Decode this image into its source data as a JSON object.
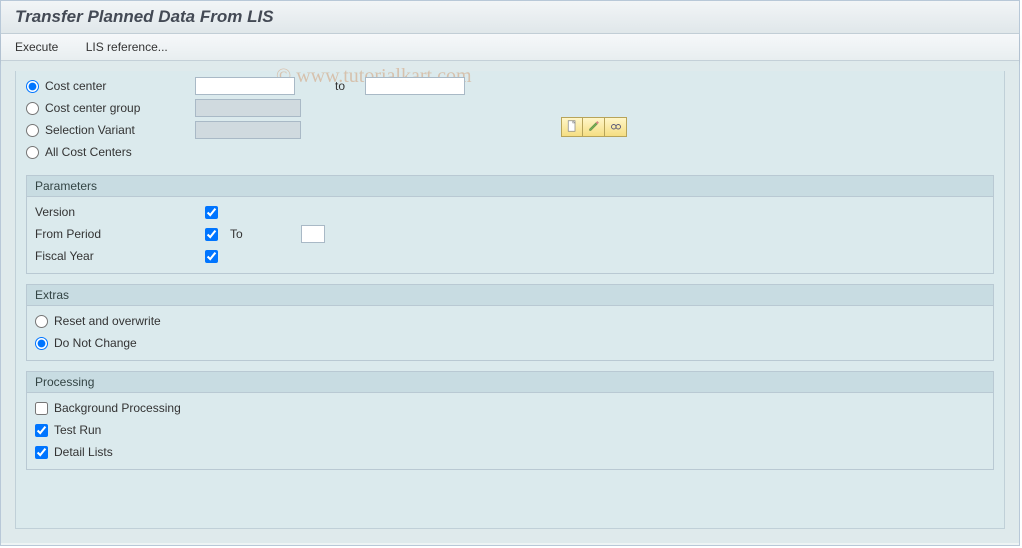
{
  "title": "Transfer Planned Data From LIS",
  "toolbar": {
    "execute": "Execute",
    "lis_ref": "LIS reference..."
  },
  "watermark": "© www.tutorialkart.com",
  "selection": {
    "opt1": "Cost center",
    "opt2": "Cost center group",
    "opt3": "Selection Variant",
    "opt4": "All Cost Centers",
    "to": "to",
    "cc_from": "",
    "cc_to": "",
    "ccgrp": "",
    "selvar": ""
  },
  "parameters": {
    "title": "Parameters",
    "version": "Version",
    "from_period": "From Period",
    "to": "To",
    "fiscal_year": "Fiscal Year",
    "to_val": ""
  },
  "extras": {
    "title": "Extras",
    "opt1": "Reset and overwrite",
    "opt2": "Do Not Change"
  },
  "processing": {
    "title": "Processing",
    "opt1": "Background Processing",
    "opt2": "Test Run",
    "opt3": "Detail Lists"
  },
  "icons": {
    "create": "create-icon",
    "edit": "edit-icon",
    "variant": "variant-icon"
  }
}
